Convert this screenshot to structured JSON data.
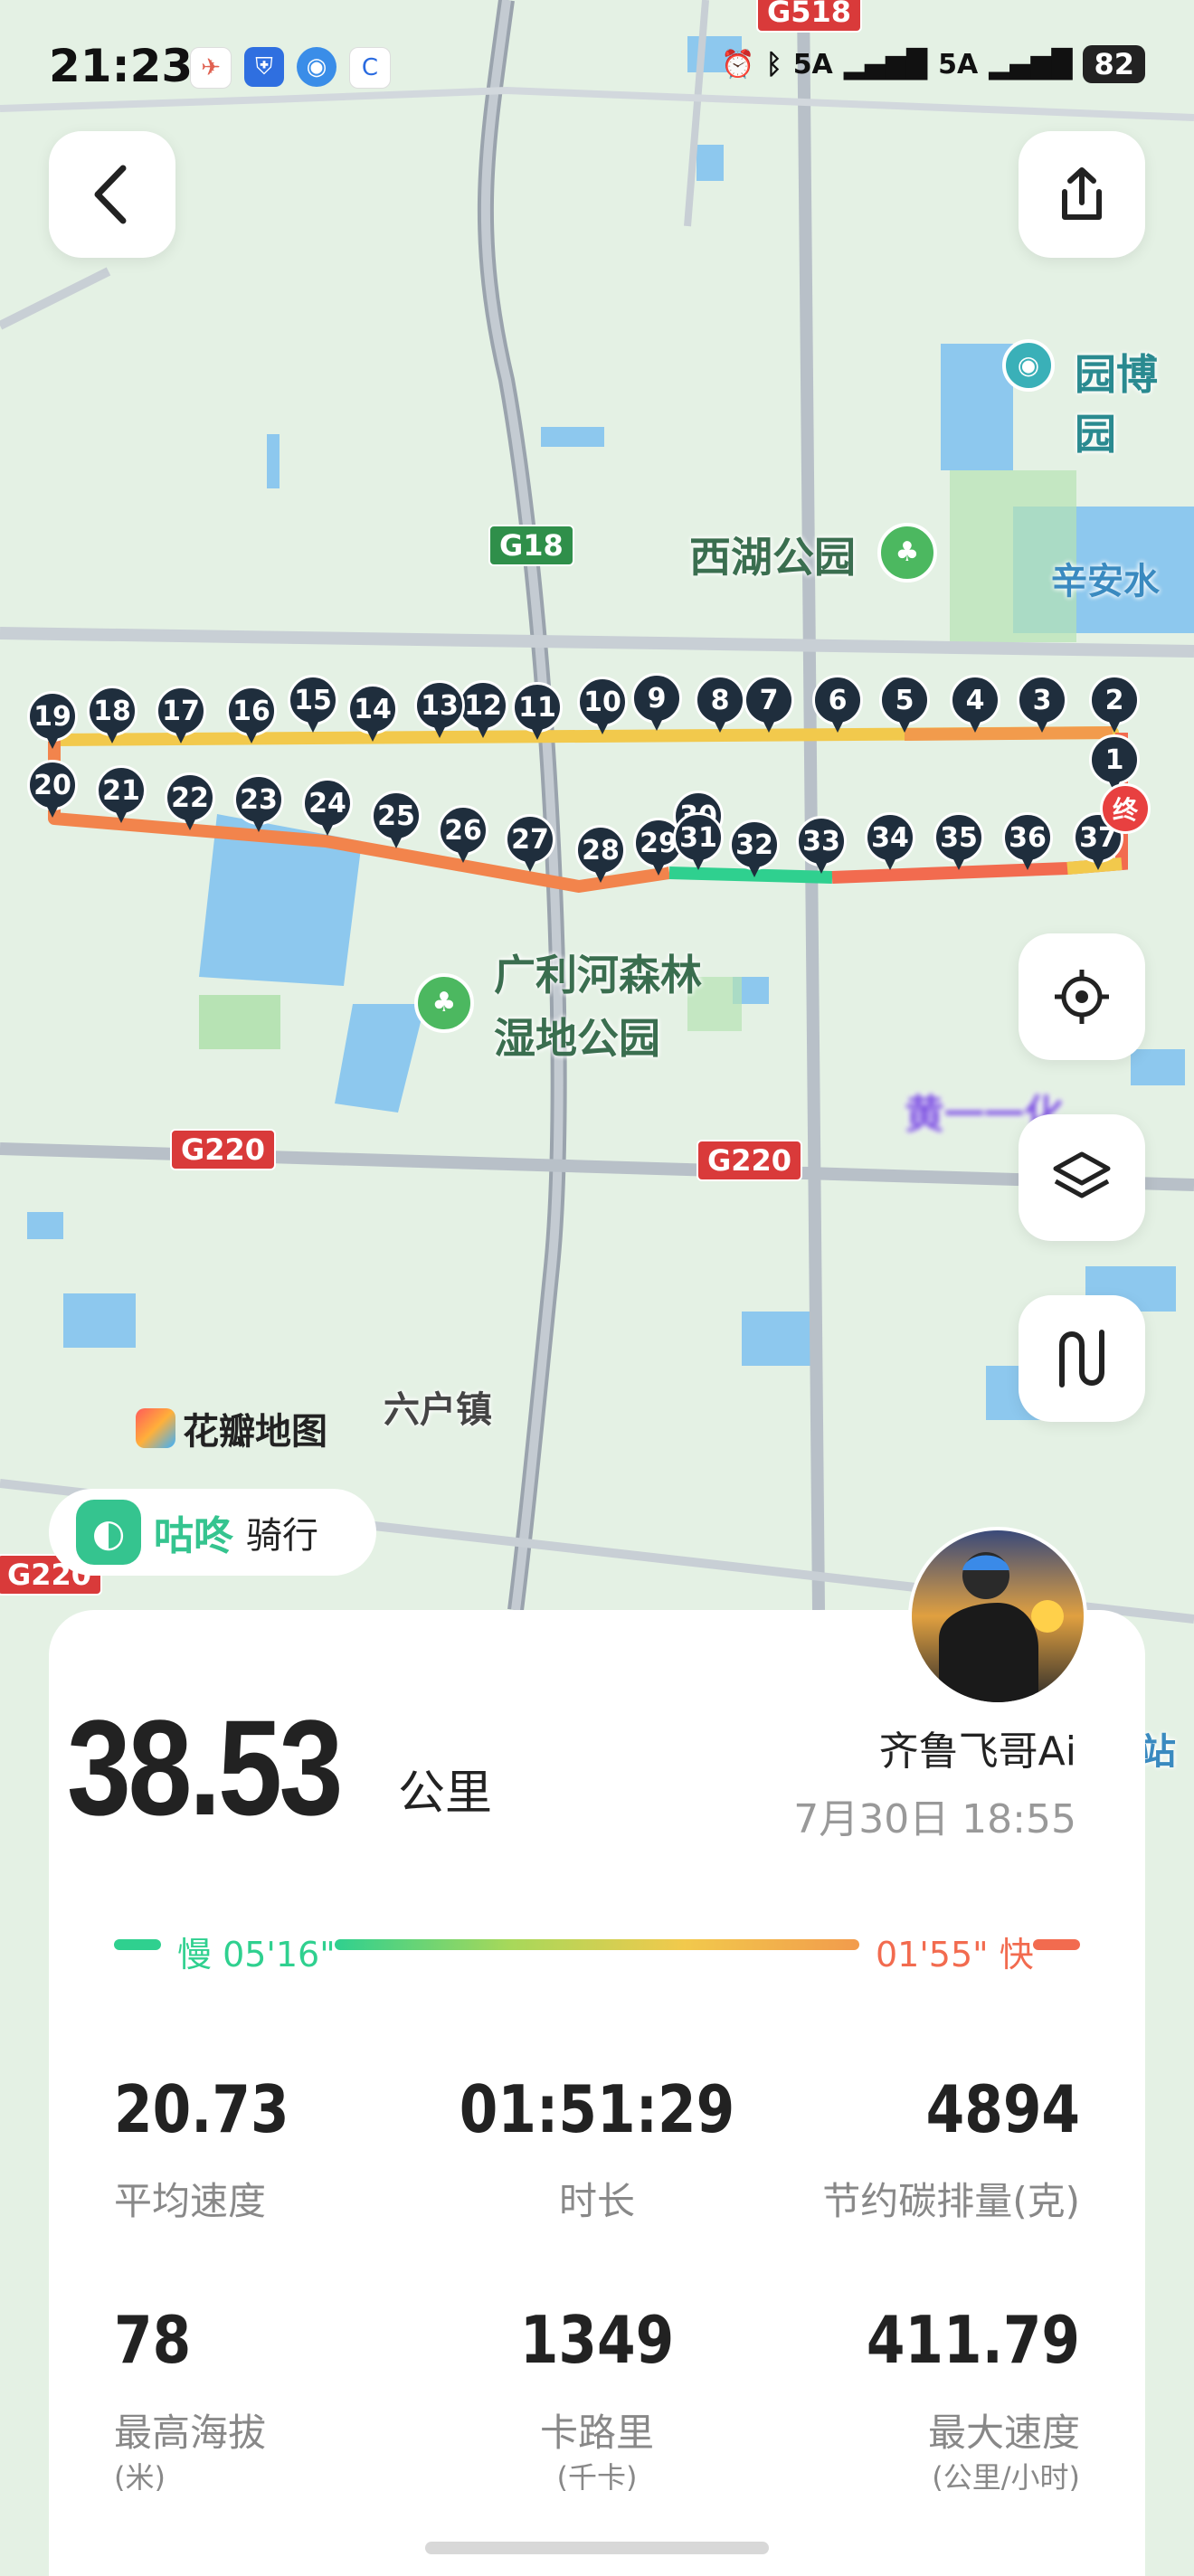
{
  "status_bar": {
    "time": "21:23",
    "signal_1": "5A",
    "signal_2": "5A",
    "battery": "82"
  },
  "map": {
    "labels": {
      "park_1": "西湖公园",
      "park_2_line1": "广利河森林",
      "park_2_line2": "湿地公园",
      "poi_1": "园博园",
      "poi_2": "辛安水",
      "town": "六户镇",
      "side": "站",
      "blurred": "黄一一化"
    },
    "road_badges": [
      "G518",
      "G18",
      "G220",
      "G220",
      "G220"
    ],
    "markers": [
      "1",
      "2",
      "3",
      "4",
      "5",
      "6",
      "7",
      "8",
      "9",
      "10",
      "11",
      "12",
      "13",
      "14",
      "15",
      "16",
      "17",
      "18",
      "19",
      "20",
      "21",
      "22",
      "23",
      "24",
      "25",
      "26",
      "27",
      "28",
      "29",
      "30",
      "31",
      "32",
      "33",
      "34",
      "35",
      "36",
      "37"
    ],
    "end_label": "终",
    "watermark": "花瓣地图"
  },
  "app_badge": {
    "brand": "咕咚",
    "activity": "骑行"
  },
  "summary": {
    "distance": "38.53",
    "distance_unit": "公里",
    "user_name": "齐鲁飞哥Ai",
    "date": "7月30日 18:55",
    "pace_slow": "慢 05'16\"",
    "pace_fast": "01'55\" 快"
  },
  "stats": [
    {
      "value": "20.73",
      "label": "平均速度",
      "sub": ""
    },
    {
      "value": "01:51:29",
      "label": "时长",
      "sub": ""
    },
    {
      "value": "4894",
      "label": "节约碳排量(克)",
      "sub": ""
    },
    {
      "value": "78",
      "label": "最高海拔",
      "sub": "(米)"
    },
    {
      "value": "1349",
      "label": "卡路里",
      "sub": "(千卡)"
    },
    {
      "value": "411.79",
      "label": "最大速度",
      "sub": "(公里/小时)"
    }
  ],
  "colors": {
    "slow": "#2fd08f",
    "mid": "#f2c94c",
    "fast": "#f26b4f",
    "marker": "#1f2e3d",
    "brand": "#35c48f"
  }
}
